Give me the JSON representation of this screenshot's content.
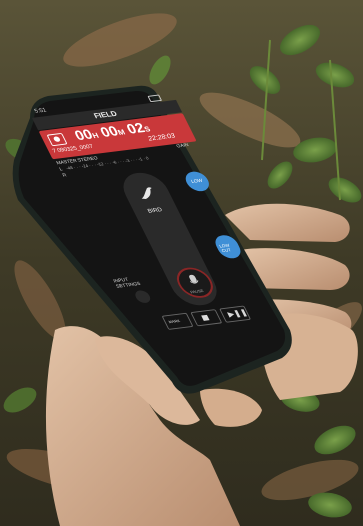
{
  "app": {
    "status_time": "5:51",
    "title": "FIELD",
    "timecode": {
      "hours": "00",
      "h_unit": "H",
      "minutes": "00",
      "m_unit": "M",
      "seconds": "02",
      "s_unit": "S"
    },
    "take_name": "7 090325_0007",
    "remaining": "22:28:03",
    "meter_labels": {
      "master": "MASTER",
      "stereo": "STEREO",
      "left": "L",
      "right": "R",
      "scale": "-48 · · · -24 · · · -12 · · · -6 · · · -3 · · · -1 · 0"
    },
    "gain_label": "GAIN",
    "gain_button": "LOW",
    "preset_label": "BIRD",
    "record_label": "PAUSE",
    "lowcut_button": "LOW CUT",
    "input_settings_label": "INPUT\nSETTINGS",
    "transport": [
      "MARK",
      "STOP",
      "PLAY"
    ]
  },
  "colors": {
    "header_red": "#b3262c",
    "timecode_bg": "#c9383a",
    "accent_blue": "#3f8fd6",
    "screen_bg": "#141414"
  },
  "icons": [
    "bird-icon",
    "microphone-icon",
    "record-icon",
    "stop-icon",
    "play-pause-icon",
    "battery-icon",
    "wifi-icon"
  ]
}
